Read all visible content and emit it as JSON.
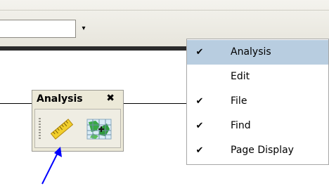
{
  "toolbar": {
    "combo_value": "",
    "dropdown_arrow": "▾"
  },
  "panel": {
    "title": "Analysis",
    "close_glyph": "✖",
    "tools": [
      {
        "icon": "ruler-icon"
      },
      {
        "icon": "grid-map-icon"
      }
    ]
  },
  "menu": {
    "items": [
      {
        "label": "Analysis",
        "checked": true,
        "highlighted": true,
        "check": "✔"
      },
      {
        "label": "Edit",
        "checked": false,
        "highlighted": false,
        "check": ""
      },
      {
        "label": "File",
        "checked": true,
        "highlighted": false,
        "check": "✔"
      },
      {
        "label": "Find",
        "checked": true,
        "highlighted": false,
        "check": "✔"
      },
      {
        "label": "Page Display",
        "checked": true,
        "highlighted": false,
        "check": "✔"
      }
    ]
  },
  "colors": {
    "menu_highlight": "#b8cde0",
    "arrow": "#0000ff",
    "toolbar_bg": "#ece9d8"
  }
}
